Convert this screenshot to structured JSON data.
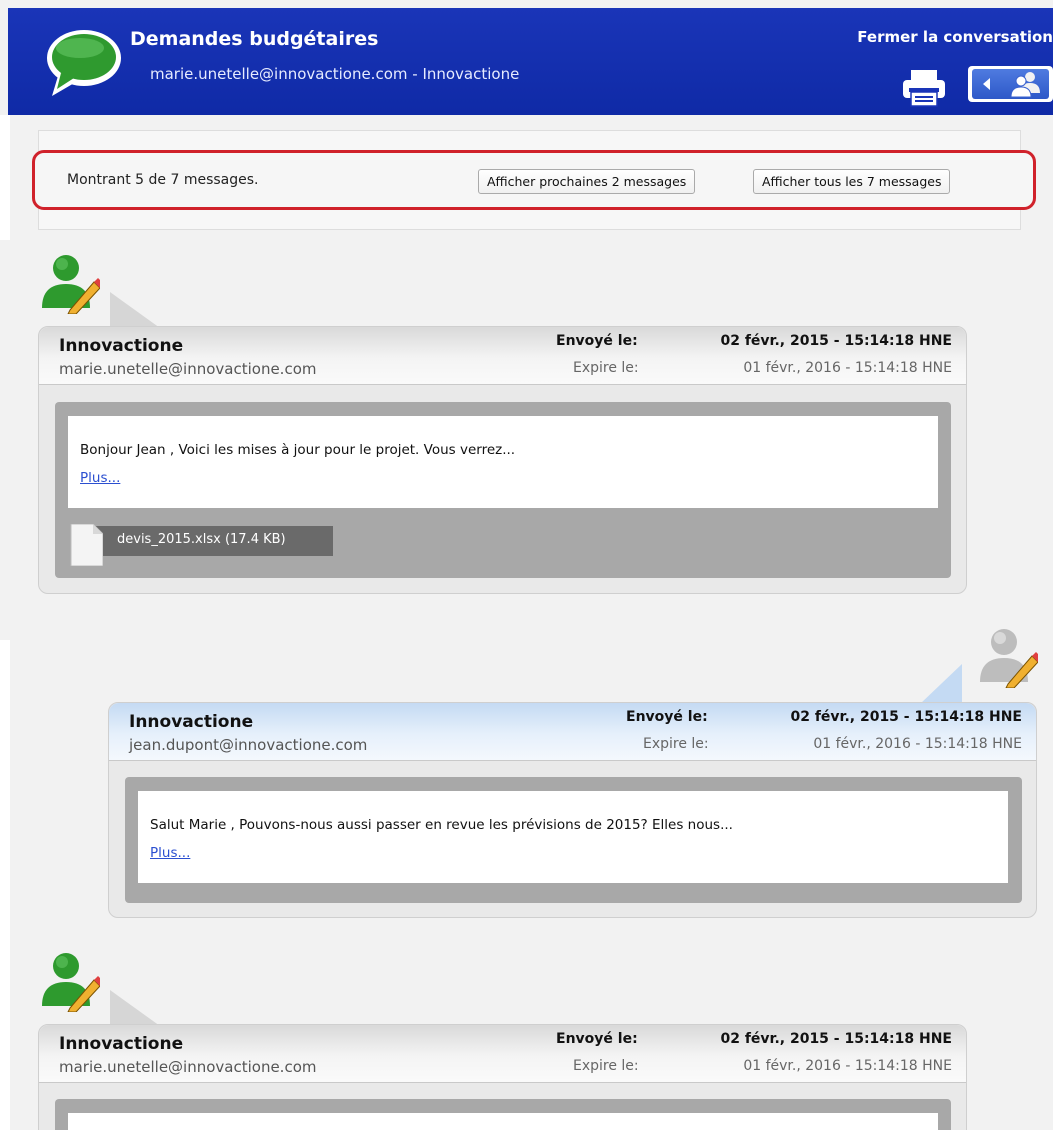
{
  "header": {
    "title": "Demandes budgétaires",
    "subtitle": "marie.unetelle@innovactione.com - Innovactione",
    "close_label": "Fermer la conversation",
    "icons": [
      "chat-bubble-icon",
      "printer-icon",
      "people-icon",
      "arrow-left-icon"
    ],
    "colors": {
      "bar": "#1a35b8",
      "bubble": "#2f9a2f"
    }
  },
  "info": {
    "summary": "Montrant 5 de 7 messages.",
    "next_button": "Afficher prochaines 2 messages",
    "all_button": "Afficher tous les 7 messages",
    "highlight_color": "#d0222b"
  },
  "messages": [
    {
      "sender": "Innovactione",
      "email": "marie.unetelle@innovactione.com",
      "sent_label": "Envoyé le:",
      "sent_value": "02 févr., 2015 - 15:14:18 HNE",
      "expires_label": "Expire le:",
      "expires_value": "01 févr., 2016 - 15:14:18 HNE",
      "body": "Bonjour Jean , Voici les mises à jour pour le projet. Vous verrez...",
      "more": "Plus...",
      "attachment": "devis_2015.xlsx (17.4 KB)",
      "avatar": "green-user-pencil-icon"
    },
    {
      "sender": "Innovactione",
      "email": "jean.dupont@innovactione.com",
      "sent_label": "Envoyé le:",
      "sent_value": "02 févr., 2015 - 15:14:18 HNE",
      "expires_label": "Expire le:",
      "expires_value": "01 févr., 2016 - 15:14:18 HNE",
      "body": "Salut Marie , Pouvons-nous aussi passer en revue les prévisions de 2015? Elles nous...",
      "more": "Plus...",
      "avatar": "gray-user-pencil-icon"
    },
    {
      "sender": "Innovactione",
      "email": "marie.unetelle@innovactione.com",
      "sent_label": "Envoyé le:",
      "sent_value": "02 févr., 2015 - 15:14:18 HNE",
      "expires_label": "Expire le:",
      "expires_value": "01 févr., 2016 - 15:14:18 HNE",
      "avatar": "green-user-pencil-icon"
    }
  ]
}
